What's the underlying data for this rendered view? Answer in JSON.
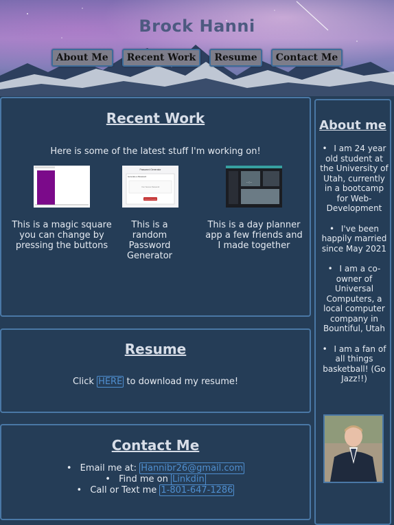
{
  "header": {
    "title": "Brock Hanni",
    "nav": [
      "About Me",
      "Recent Work",
      "Resume",
      "Contact Me"
    ]
  },
  "recent_work": {
    "heading": "Recent Work",
    "intro": "Here is some of the latest stuff I'm working on!",
    "projects": [
      {
        "caption": "This is a magic square you can change by pressing the buttons",
        "thumb": "purple-square-screenshot"
      },
      {
        "caption": "This is a random Password Generator",
        "thumb": "password-generator-screenshot",
        "thumb_title": "Password Generator",
        "thumb_sub": "Generate a Password",
        "thumb_field": "Your Secure Password",
        "thumb_button": "Generate Password"
      },
      {
        "caption": "This is a day planner app a few friends and I made together",
        "thumb": "day-planner-screenshot"
      }
    ]
  },
  "resume": {
    "heading": "Resume",
    "prefix": "Click",
    "link": "HERE",
    "suffix": "to download my resume!"
  },
  "contact": {
    "heading": "Contact Me",
    "items": [
      {
        "label": "Email me at:",
        "link": "Hannibr26@gmail.com"
      },
      {
        "label": "Find me on",
        "link": "Linkdin"
      },
      {
        "label": "Call or Text me",
        "link": "1-801-647-1286"
      }
    ]
  },
  "about": {
    "heading": "About me",
    "items": [
      "I am 24 year old student at the University of Utah, currently in a bootcamp for Web-Development",
      "I've been happily married since May 2021",
      "I am a co-owner of Universal Computers, a local computer company in Bountiful, Utah",
      "I am a fan of all things basketball! (Go Jazz!!)"
    ],
    "photo": "profile-photo"
  },
  "colors": {
    "background": "#253d57",
    "border": "#4a78a6",
    "link": "#4f8fd0",
    "nav_button": "#7d7d8a"
  }
}
